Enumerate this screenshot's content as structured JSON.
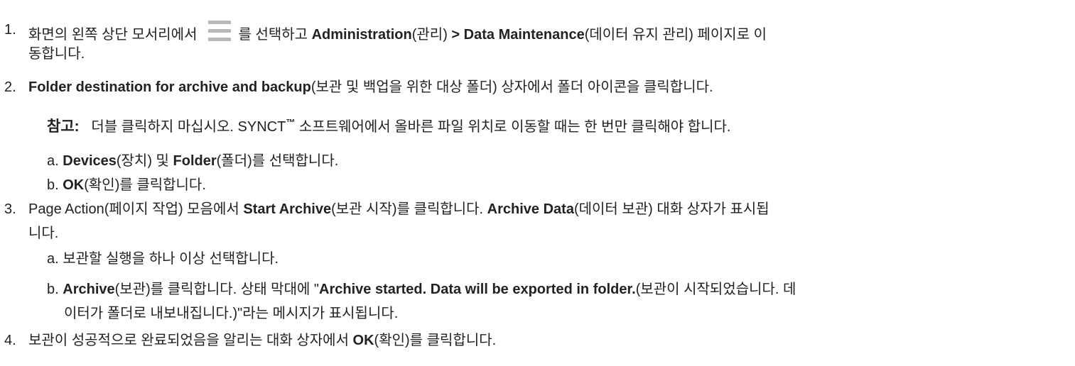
{
  "steps": [
    {
      "number": "1.",
      "line1_before_icon": "화면의 왼쪽 상단 모서리에서",
      "icon": "hamburger-menu-icon",
      "line1_after_icon": "를 선택하고",
      "admin_bold": "Administration",
      "admin_kr": "(관리)",
      "dm_bold": "> Data Maintenance",
      "dm_kr": "(데이터 유지 관리) 페이지로 이",
      "line2": "동합니다."
    },
    {
      "number": "2.",
      "folder_bold": "Folder destination for archive and backup",
      "folder_rest": "(보관 및 백업을 위한 대상 폴더) 상자에서 폴더 아이콘을 클릭합니다.",
      "note_label": "참고:",
      "note_text_1": "더블 클릭하지 마십시오. SYNCT",
      "note_tm": "™",
      "note_text_2": "소프트웨어에서 올바른 파일 위치로 이동할 때는 한 번만 클릭해야 합니다.",
      "sub_a_prefix": "a.",
      "sub_a_devices": "Devices",
      "sub_a_mid": "(장치) 및",
      "sub_a_folder": "Folder",
      "sub_a_rest": "(폴더)를 선택합니다.",
      "sub_b_prefix": "b.",
      "sub_b_ok": "OK",
      "sub_b_rest": "(확인)를 클릭합니다."
    },
    {
      "number": "3.",
      "part1": "Page Action(페이지 작업) 모음에서",
      "start_bold": "Start Archive",
      "part2": "(보관 시작)를 클릭합니다.",
      "archive_data_bold": "Archive Data",
      "part3": "(데이터 보관) 대화 상자가 표시됩",
      "line2": "니다.",
      "sub_a": "a. 보관할 실행을 하나 이상 선택합니다.",
      "sub_b_prefix": "b.",
      "sub_b_archive": "Archive",
      "sub_b_mid": "(보관)를 클릭합니다. 상태 막대에 \"",
      "sub_b_msg": "Archive started. Data will be exported in folder.",
      "sub_b_rest": "(보관이 시작되었습니다. 데",
      "sub_b_line2": "이터가 폴더로 내보내집니다.)\"라는 메시지가 표시됩니다."
    },
    {
      "number": "4.",
      "part1": "보관이 성공적으로 완료되었음을 알리는 대화 상자에서",
      "ok_bold": "OK",
      "part2": "(확인)를 클릭합니다."
    }
  ]
}
